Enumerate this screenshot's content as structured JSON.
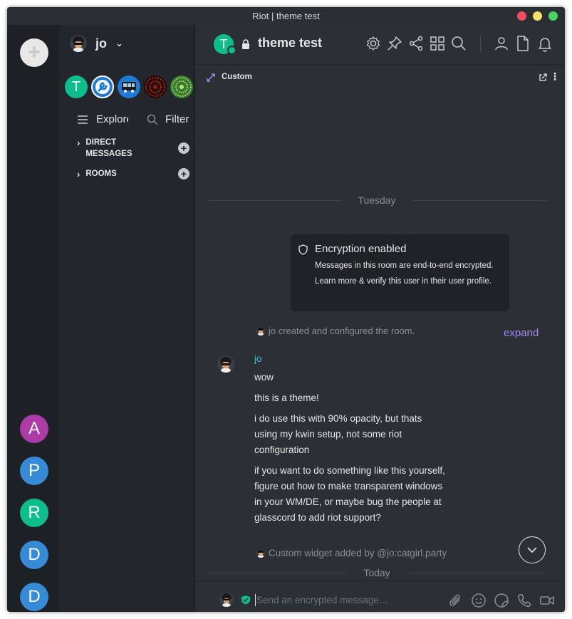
{
  "window": {
    "title": "Riot | theme test"
  },
  "spaces": {
    "add_icon": "plus-icon",
    "items": [
      {
        "letter": "A",
        "color": "#ac3ba8"
      },
      {
        "letter": "P",
        "color": "#368bd6"
      },
      {
        "letter": "R",
        "color": "#0dbd8b"
      },
      {
        "letter": "D",
        "color": "#368bd6"
      },
      {
        "letter": "D",
        "color": "#368bd6"
      }
    ]
  },
  "sidebar": {
    "user_name": "jo",
    "room_avatars": [
      {
        "letter": "T",
        "color": "#0dbd8b"
      },
      {
        "letter": "",
        "color": "#ffffff",
        "icon": "wrench-icon"
      },
      {
        "letter": "",
        "color": "#1e7ad6",
        "icon": "bus-icon"
      },
      {
        "letter": "",
        "color": "#2a0808",
        "icon": "mandala-icon"
      },
      {
        "letter": "",
        "color": "#3a7a2a",
        "icon": "mandala-icon"
      }
    ],
    "explore_label": "Explore",
    "filter_label": "Filter",
    "sections": [
      {
        "label_line1": "DIRECT",
        "label_line2": "MESSAGES"
      },
      {
        "label_line1": "ROOMS",
        "label_line2": ""
      }
    ]
  },
  "room": {
    "name": "theme test",
    "avatar_letter": "T",
    "widget_title": "Custom"
  },
  "timeline": {
    "date_tuesday": "Tuesday",
    "encryption": {
      "title": "Encryption enabled",
      "body": "Messages in this room are end-to-end encrypted. Learn more & verify this user in their user profile."
    },
    "created_text": "jo created and configured the room.",
    "expand_label": "expand",
    "sender": "jo",
    "messages": [
      "wow",
      "this is a theme!",
      "i do use this with 90% opacity, but thats using my kwin setup, not some riot configuration",
      "if you want to do something like this yourself, figure out how to make transparent windows in your WM/DE, or maybe bug the people at glasscord to add riot support?"
    ],
    "widget_added_text": "Custom widget added by @jo:catgirl.party",
    "date_today": "Today"
  },
  "composer": {
    "placeholder": "Send an encrypted message…"
  },
  "colors": {
    "accent": "#0dbd8b",
    "link": "#a78bf3",
    "sender": "#2dc2c5"
  }
}
